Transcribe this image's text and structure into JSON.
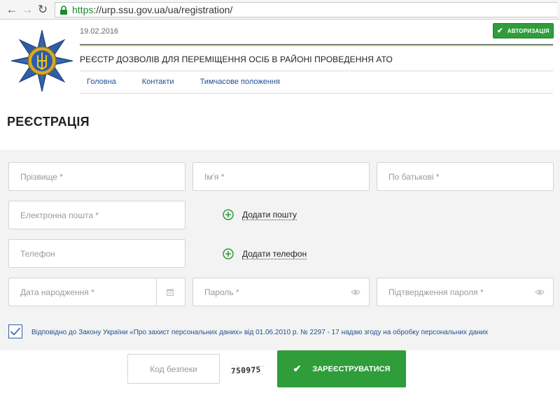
{
  "browser": {
    "url_scheme": "https",
    "url_rest": "://urp.ssu.gov.ua/ua/registration/"
  },
  "header": {
    "date": "19.02.2016",
    "auth_label": "АВТОРИЗАЦІЯ",
    "registry_title": "РЕЄСТР ДОЗВОЛІВ ДЛЯ ПЕРЕМІЩЕННЯ ОСІБ В РАЙОНІ ПРОВЕДЕННЯ АТО",
    "menu": [
      "Головна",
      "Контакти",
      "Тимчасове положення"
    ]
  },
  "page": {
    "title": "РЕЄСТРАЦІЯ"
  },
  "form": {
    "surname": "Прізвище *",
    "name": "Ім'я *",
    "patronymic": "По батькові *",
    "email": "Електронна пошта *",
    "add_email": "Додати пошту",
    "phone": "Телефон",
    "add_phone": "Додати телефон",
    "birth_date": "Дата народження *",
    "password": "Пароль *",
    "password_confirm": "Підтвердження пароля *",
    "consent": "Відповідно до Закону України «Про захист персональних даних» від 01.06.2010 р. № 2297 - 17 надаю згоду на обробку персональних даних",
    "security_code": "Код безпеки",
    "captcha": "750975",
    "submit": "ЗАРЕЄСТРУВАТИСЯ"
  },
  "colors": {
    "accent_green": "#2e9d3a",
    "link_blue": "#1f4f8f",
    "flag_blue": "#2f5ea8",
    "flag_yellow": "#f3c318"
  }
}
